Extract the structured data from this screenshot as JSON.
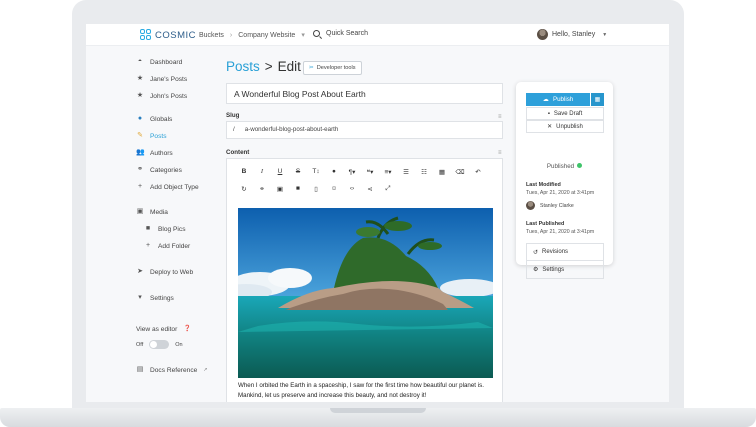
{
  "brand": {
    "name": "COSMIC"
  },
  "topbar": {
    "breadcrumbs": [
      "Buckets",
      "Company Website"
    ],
    "search_label": "Quick Search",
    "user_greeting": "Hello, Stanley"
  },
  "sidebar": {
    "items": [
      {
        "label": "Dashboard"
      },
      {
        "label": "Jane's Posts"
      },
      {
        "label": "John's Posts"
      },
      {
        "label": "Globals"
      },
      {
        "label": "Posts"
      },
      {
        "label": "Authors"
      },
      {
        "label": "Categories"
      },
      {
        "label": "Add Object Type"
      },
      {
        "label": "Media"
      },
      {
        "label": "Blog Pics"
      },
      {
        "label": "Add Folder"
      },
      {
        "label": "Deploy to Web"
      },
      {
        "label": "Settings"
      }
    ],
    "view_as_editor": {
      "label": "View as editor",
      "off": "Off",
      "on": "On"
    },
    "docs_label": "Docs Reference"
  },
  "main": {
    "title_section": "Posts",
    "title_sep": ">",
    "title_action": "Edit",
    "devtools_label": "Developer tools",
    "post_title": "A Wonderful Blog Post About Earth",
    "slug_label": "Slug",
    "slug_prefix": "/",
    "slug_value": "a-wonderful-blog-post-about-earth",
    "content_label": "Content",
    "body_text": "When I orbited the Earth in a spaceship, I saw for the first time how beautiful our planet is. Mankind, let us preserve and increase this beauty, and not destroy it!"
  },
  "publish_card": {
    "publish_label": "Publish",
    "save_draft_label": "Save Draft",
    "unpublish_label": "Unpublish",
    "status": "Published",
    "last_modified_label": "Last Modified",
    "last_modified_value": "Tues, Apr 21, 2020 at 3:41pm",
    "modified_by": "Stanley Clarke",
    "last_published_label": "Last Published",
    "last_published_value": "Tues, Apr 21, 2020 at 3:41pm",
    "revisions_label": "Revisions",
    "settings_label": "Settings"
  },
  "colors": {
    "accent": "#29a0d6",
    "published": "#3fc46a"
  }
}
